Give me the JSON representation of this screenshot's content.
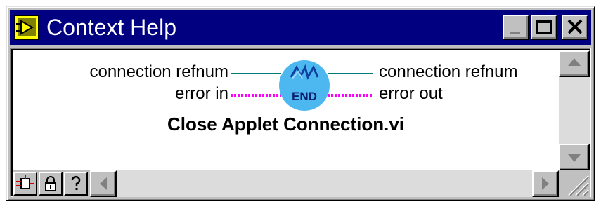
{
  "window": {
    "title": "Context Help",
    "title_icon": "labview-context-help-icon",
    "titlebar_color": "#000080",
    "controls": {
      "minimize": "minimize-icon",
      "maximize": "maximize-icon",
      "close": "close-icon"
    }
  },
  "help": {
    "inputs": [
      {
        "label": "connection refnum",
        "wire_color": "#007b7b",
        "wire_style": "solid"
      },
      {
        "label": "error in",
        "wire_color": "#ff00ff",
        "wire_style": "dotted"
      }
    ],
    "outputs": [
      {
        "label": "connection refnum",
        "wire_color": "#007b7b",
        "wire_style": "solid"
      },
      {
        "label": "error out",
        "wire_color": "#ff00ff",
        "wire_style": "dotted"
      }
    ],
    "vi_icon": {
      "name": "close-applet-connection-icon",
      "text": "END",
      "color": "#4db8f0"
    },
    "vi_name": "Close Applet Connection.vi"
  },
  "toolbar": [
    {
      "name": "show-simple-diagram-icon"
    },
    {
      "name": "lock-icon"
    },
    {
      "name": "help-question-icon"
    }
  ],
  "scrollbars": {
    "vertical": {
      "up": "scroll-up-arrow-icon",
      "down": "scroll-down-arrow-icon"
    },
    "horizontal": {
      "left": "scroll-left-arrow-icon",
      "right": "scroll-right-arrow-icon"
    }
  }
}
